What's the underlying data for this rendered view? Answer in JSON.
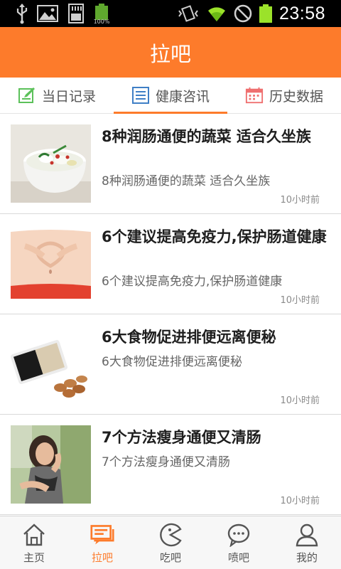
{
  "status_bar": {
    "battery_small_label": "100%",
    "time": "23:58",
    "icons": [
      "usb-icon",
      "image-icon",
      "sd-card-icon",
      "battery-icon",
      "vibrate-icon",
      "wifi-icon",
      "no-sim-icon",
      "battery-icon"
    ]
  },
  "header": {
    "title": "拉吧"
  },
  "tabs": [
    {
      "label": "当日记录",
      "icon": "edit-icon",
      "active": false
    },
    {
      "label": "健康咨讯",
      "icon": "list-icon",
      "active": true
    },
    {
      "label": "历史数据",
      "icon": "calendar-icon",
      "active": false
    }
  ],
  "articles": [
    {
      "title": "8种润肠通便的蔬菜 适合久坐族",
      "summary": "8种润肠通便的蔬菜 适合久坐族",
      "time": "10小时前",
      "image": "vegetable-soup"
    },
    {
      "title": "6个建议提高免疫力,保护肠道健康",
      "summary": "6个建议提高免疫力,保护肠道健康",
      "time": "10小时前",
      "image": "belly-hands"
    },
    {
      "title": "6大食物促进排便远离便秘",
      "summary": "6大食物促进排便远离便秘",
      "time": "10小时前",
      "image": "sesame-almonds"
    },
    {
      "title": "7个方法瘦身通便又清肠",
      "summary": "7个方法瘦身通便又清肠",
      "time": "10小时前",
      "image": "woman-portrait"
    }
  ],
  "bottom_nav": [
    {
      "label": "主页",
      "icon": "home-icon",
      "active": false
    },
    {
      "label": "拉吧",
      "icon": "chat-board-icon",
      "active": true
    },
    {
      "label": "吃吧",
      "icon": "pacman-icon",
      "active": false
    },
    {
      "label": "喷吧",
      "icon": "speech-bubble-icon",
      "active": false
    },
    {
      "label": "我的",
      "icon": "user-icon",
      "active": false
    }
  ],
  "colors": {
    "accent": "#fd7b2b",
    "status_bar": "#000000",
    "battery_green": "#9be22a"
  }
}
